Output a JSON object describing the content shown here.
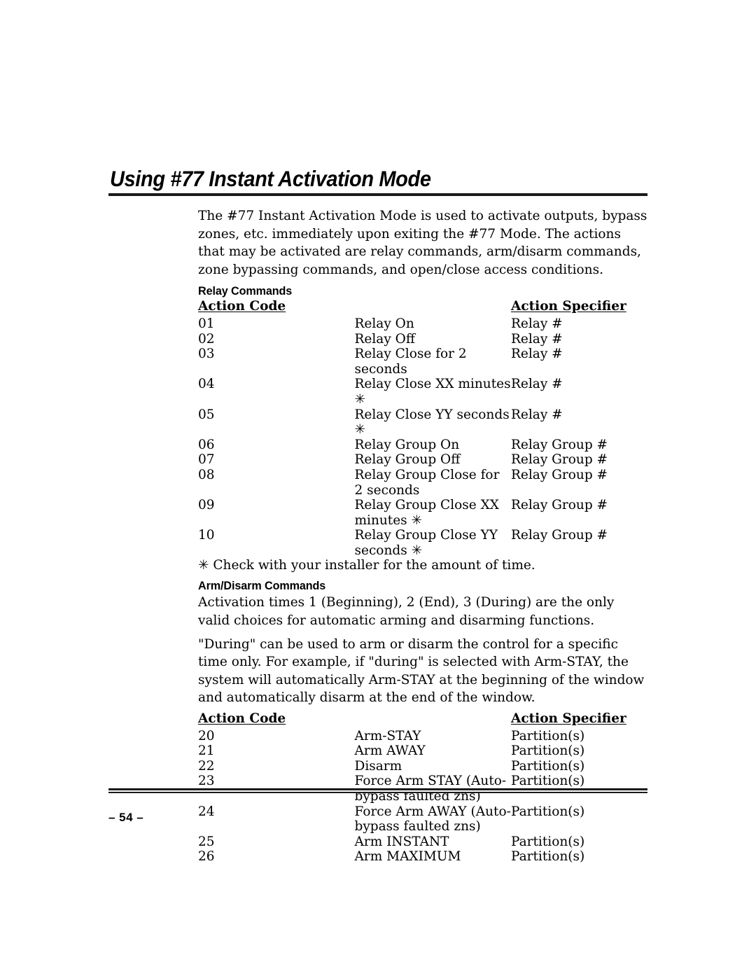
{
  "document": {
    "title": "Using #77 Instant Activation Mode",
    "page_number": "– 54 –"
  },
  "intro": {
    "paragraph": "The #77 Instant Activation Mode is used to activate outputs, bypass zones, etc. immediately upon exiting the #77 Mode. The actions that may be activated are relay commands, arm/disarm commands, zone bypassing commands, and open/close access conditions."
  },
  "relay_section": {
    "heading": "Relay Commands",
    "columns": {
      "action_code": "Action Code",
      "action_specifier": "Action Specifier"
    },
    "rows": [
      {
        "code": "01",
        "description": "Relay On",
        "specifier": "Relay #"
      },
      {
        "code": "02",
        "description": "Relay Off",
        "specifier": "Relay #"
      },
      {
        "code": "03",
        "description": "Relay Close for 2 seconds",
        "specifier": "Relay #"
      },
      {
        "code": "04",
        "description": "Relay Close XX minutes ✳",
        "specifier": "Relay #"
      },
      {
        "code": "05",
        "description": "Relay Close YY seconds ✳",
        "specifier": "Relay #"
      },
      {
        "code": "06",
        "description": "Relay Group On",
        "specifier": "Relay Group #"
      },
      {
        "code": "07",
        "description": "Relay Group Off",
        "specifier": "Relay Group #"
      },
      {
        "code": "08",
        "description": "Relay Group Close for 2 seconds",
        "specifier": "Relay Group #"
      },
      {
        "code": "09",
        "description": "Relay Group Close XX minutes ✳",
        "specifier": "Relay Group #"
      },
      {
        "code": "10",
        "description": "Relay Group Close YY seconds ✳",
        "specifier": "Relay Group #"
      }
    ],
    "footnote": "✳ Check with your installer for the amount of time."
  },
  "arm_disarm_section": {
    "heading": "Arm/Disarm Commands",
    "paragraph_1": "Activation times 1 (Beginning), 2 (End), 3 (During) are the only valid choices for automatic arming and disarming functions.",
    "paragraph_2": "\"During\" can be used to arm or disarm the control for a specific time only. For example, if \"during\" is selected with Arm-STAY, the system will automatically Arm-STAY at the beginning of the window and automatically disarm at the end of the window.",
    "columns": {
      "action_code": "Action Code",
      "action_specifier": "Action Specifier"
    },
    "rows": [
      {
        "code": "20",
        "description": "Arm-STAY",
        "specifier": "Partition(s)"
      },
      {
        "code": "21",
        "description": "Arm AWAY",
        "specifier": "Partition(s)"
      },
      {
        "code": "22",
        "description": "Disarm",
        "specifier": "Partition(s)"
      },
      {
        "code": "23",
        "description": "Force Arm STAY (Auto-bypass faulted zns)",
        "specifier": "Partition(s)"
      },
      {
        "code": "24",
        "description": "Force Arm AWAY (Auto-bypass faulted zns)",
        "specifier": "Partition(s)"
      },
      {
        "code": "25",
        "description": "Arm INSTANT",
        "specifier": "Partition(s)"
      },
      {
        "code": "26",
        "description": "Arm MAXIMUM",
        "specifier": "Partition(s)"
      }
    ]
  }
}
